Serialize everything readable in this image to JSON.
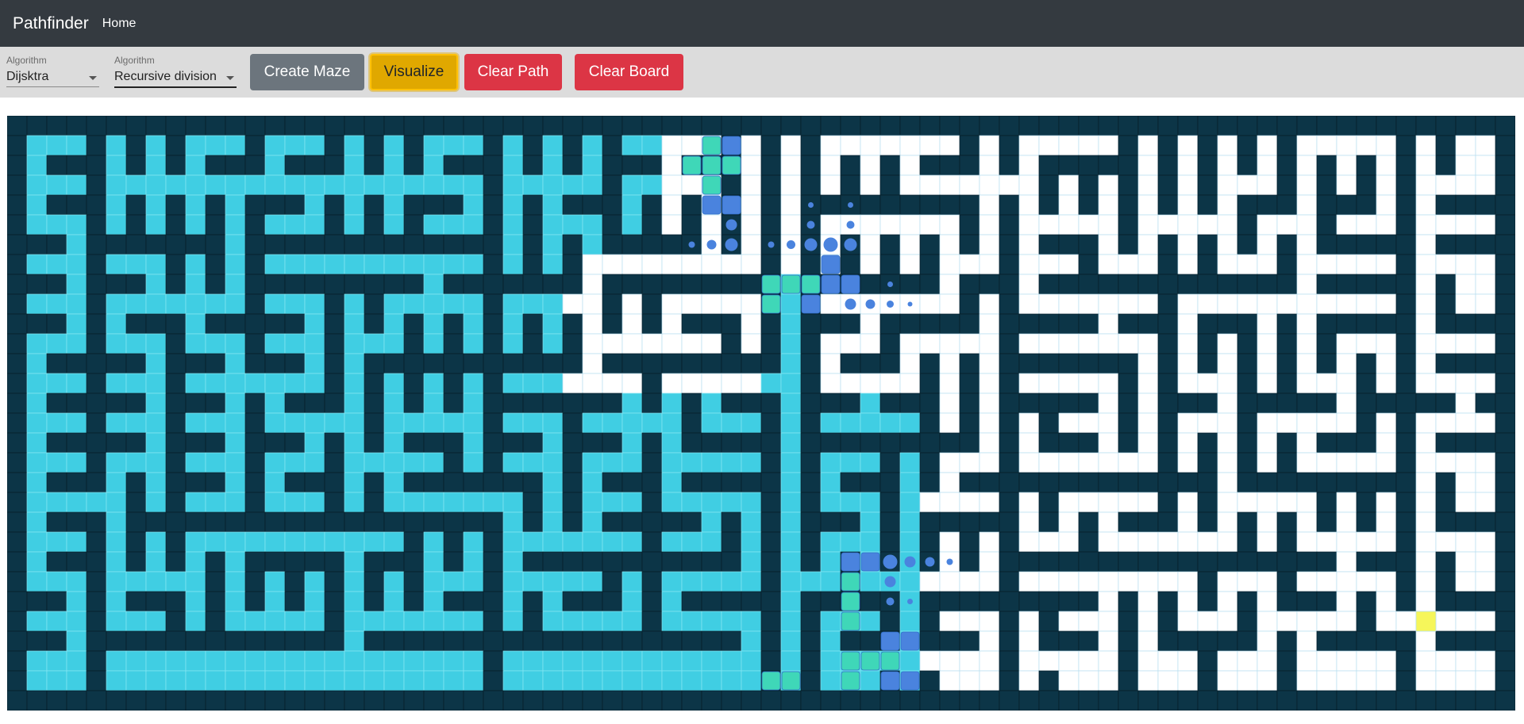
{
  "navbar": {
    "brand": "Pathfinder",
    "home_link": "Home"
  },
  "toolbar": {
    "algorithm_select": {
      "label": "Algorithm",
      "value": "Dijsktra"
    },
    "maze_select": {
      "label": "Algorithm",
      "value": "Recursive division"
    },
    "create_maze_label": "Create Maze",
    "visualize_label": "Visualize",
    "clear_path_label": "Clear Path",
    "clear_board_label": "Clear Board"
  },
  "board": {
    "columns": 76,
    "rows": 30,
    "colors": {
      "wall": "#0c3547",
      "empty": "#ffffff",
      "visited": "#40cee3",
      "frontier_teal": "#3fd7b8",
      "path_blue": "#4a83de",
      "target": "#f6f65a"
    }
  }
}
